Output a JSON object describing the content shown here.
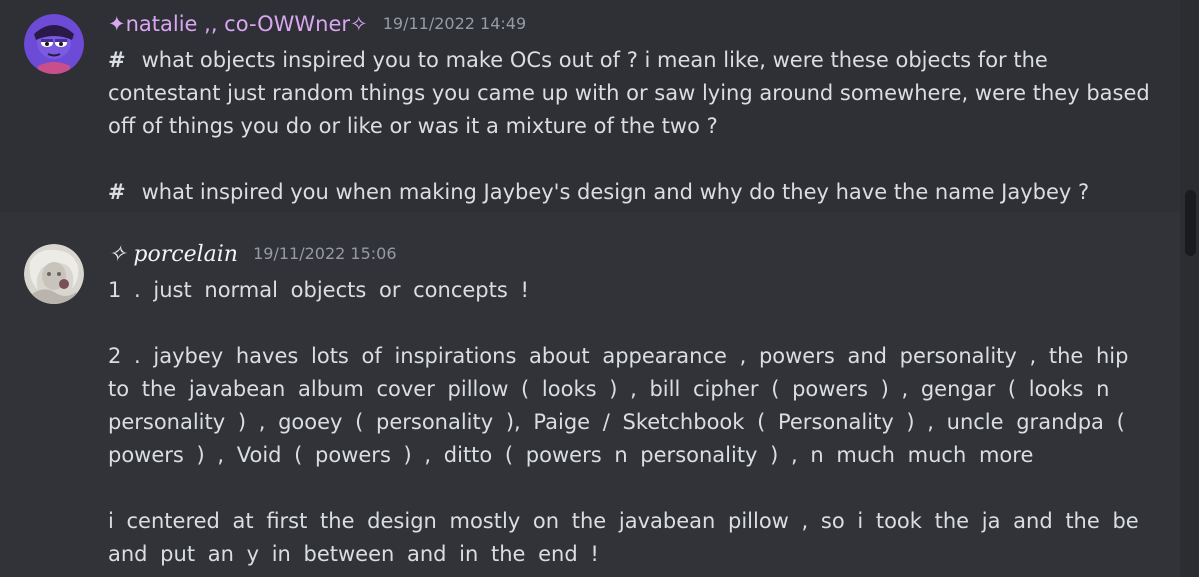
{
  "messages": [
    {
      "username": "✦natalie ,, co-OWWner✧",
      "timestamp": "19/11/2022 14:49",
      "lines": [
        "what objects inspired you to make OCs out of ? i mean like, were these objects for the",
        "contestant just random things you came up with or saw lying around somewhere, were they based",
        "off of things you do or like or was it a mixture of the two ?",
        "what inspired you when making Jaybey's design and why do they have the name Jaybey ?"
      ],
      "hash_glyph": "#"
    },
    {
      "username": "✧ porcelain",
      "timestamp": "19/11/2022 15:06",
      "lines": [
        "1 . just normal objects or concepts !",
        "2 . jaybey haves lots of inspirations about appearance , powers and personality , the hip",
        "to the javabean album cover pillow ( looks ) , bill cipher ( powers ) , gengar ( looks n",
        "personality ) , gooey ( personality ), Paige / Sketchbook ( Personality ) , uncle grandpa (",
        "powers ) , Void ( powers ) , ditto ( powers n personality ) , n much much more",
        "i centered at first the design mostly on the javabean pillow , so i took the ja and the be",
        "and put an y in between and in the end !"
      ]
    }
  ],
  "colors": {
    "background": "#313338",
    "highlight": "#2e3035",
    "username_1": "#d9a6f2",
    "username_2": "#f2f3f5",
    "timestamp": "#949ba4",
    "text": "#dbdee1"
  }
}
